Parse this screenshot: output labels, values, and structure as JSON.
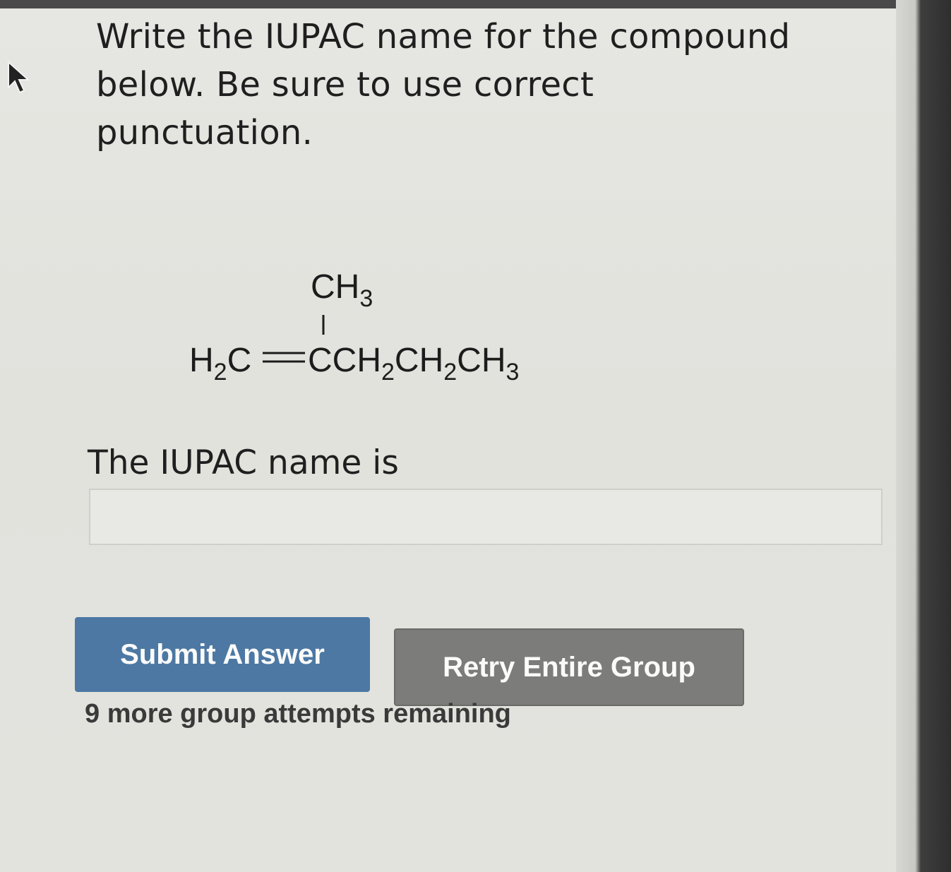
{
  "question": {
    "line1": "Write the IUPAC name for the compound",
    "line2": "below. Be sure to use correct",
    "line3": "punctuation."
  },
  "formula": {
    "branch": "CH",
    "branch_sub": "3",
    "main_h": "H",
    "main_h_sub": "2",
    "main_c": "C",
    "double_bond": "=",
    "chain_c": "CCH",
    "chain_sub1": "2",
    "chain_ch": "CH",
    "chain_sub2": "2",
    "chain_end": "CH",
    "chain_sub3": "3"
  },
  "answer": {
    "label": "The IUPAC name is",
    "value": "",
    "placeholder": ""
  },
  "buttons": {
    "submit": "Submit Answer",
    "retry": "Retry Entire Group"
  },
  "status": {
    "attempts": "9 more group attempts remaining"
  },
  "colors": {
    "submit": "#4c78a3",
    "retry": "#7c7c7a"
  },
  "icons": {
    "cursor": "mouse-pointer-icon"
  }
}
